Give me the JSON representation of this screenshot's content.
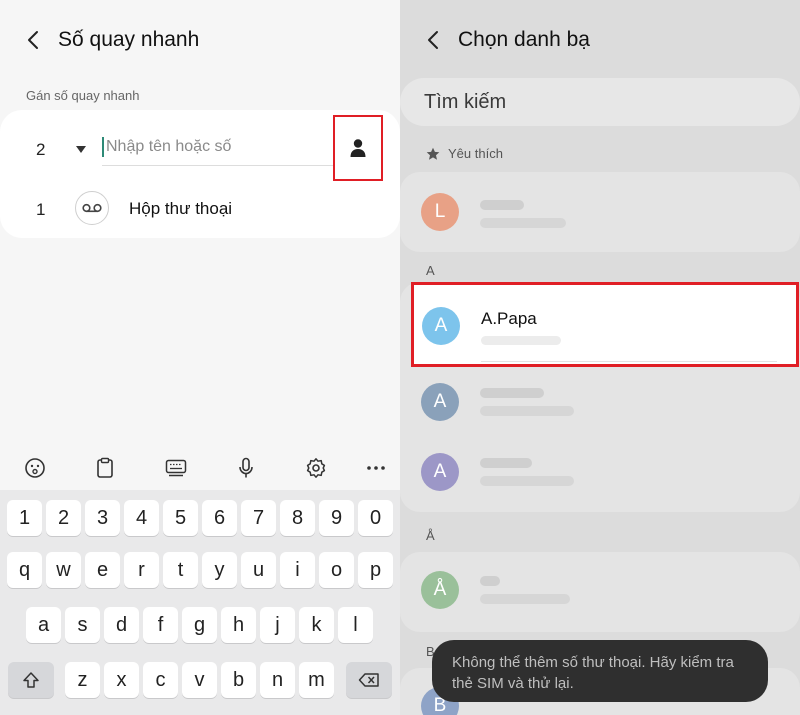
{
  "left": {
    "title": "Số quay nhanh",
    "section_label": "Gán số quay nhanh",
    "entry": {
      "number": "2",
      "placeholder": "Nhập tên hoặc số"
    },
    "voicemail": {
      "number": "1",
      "label": "Hộp thư thoại"
    },
    "toolbar_icons": [
      "emoji-icon",
      "clipboard-icon",
      "keyboard-layout-icon",
      "microphone-icon",
      "settings-icon",
      "more-icon"
    ],
    "keyboard": {
      "row_numbers": [
        "1",
        "2",
        "3",
        "4",
        "5",
        "6",
        "7",
        "8",
        "9",
        "0"
      ],
      "row_top": [
        "q",
        "w",
        "e",
        "r",
        "t",
        "y",
        "u",
        "i",
        "o",
        "p"
      ],
      "row_mid": [
        "a",
        "s",
        "d",
        "f",
        "g",
        "h",
        "j",
        "k",
        "l"
      ],
      "row_bottom": [
        "z",
        "x",
        "c",
        "v",
        "b",
        "n",
        "m"
      ]
    }
  },
  "right": {
    "title": "Chọn danh bạ",
    "search_placeholder": "Tìm kiếm",
    "favorites_label": "Yêu thích",
    "favorite_avatar": "L",
    "section_a": "A",
    "selected_contact": {
      "avatar": "A",
      "name": "A.Papa"
    },
    "contact_avatars_a": [
      "A",
      "A"
    ],
    "section_a_ring": "Å",
    "contact_avatar_a_ring": "Å",
    "section_b": "B",
    "contact_avatar_b": "B",
    "toast": "Không thể thêm số thư thoại. Hãy kiểm tra thẻ SIM và thử lại."
  },
  "colors": {
    "highlight_border": "#e01e25",
    "cursor": "#2e8a77",
    "avatar_l": "#e8a186",
    "avatar_a_selected": "#7dc4ec",
    "avatar_a": "#8aa1ba",
    "avatar_a2": "#9c97c7",
    "avatar_a_ring": "#9ac09a",
    "avatar_b": "#8ea3c7"
  }
}
